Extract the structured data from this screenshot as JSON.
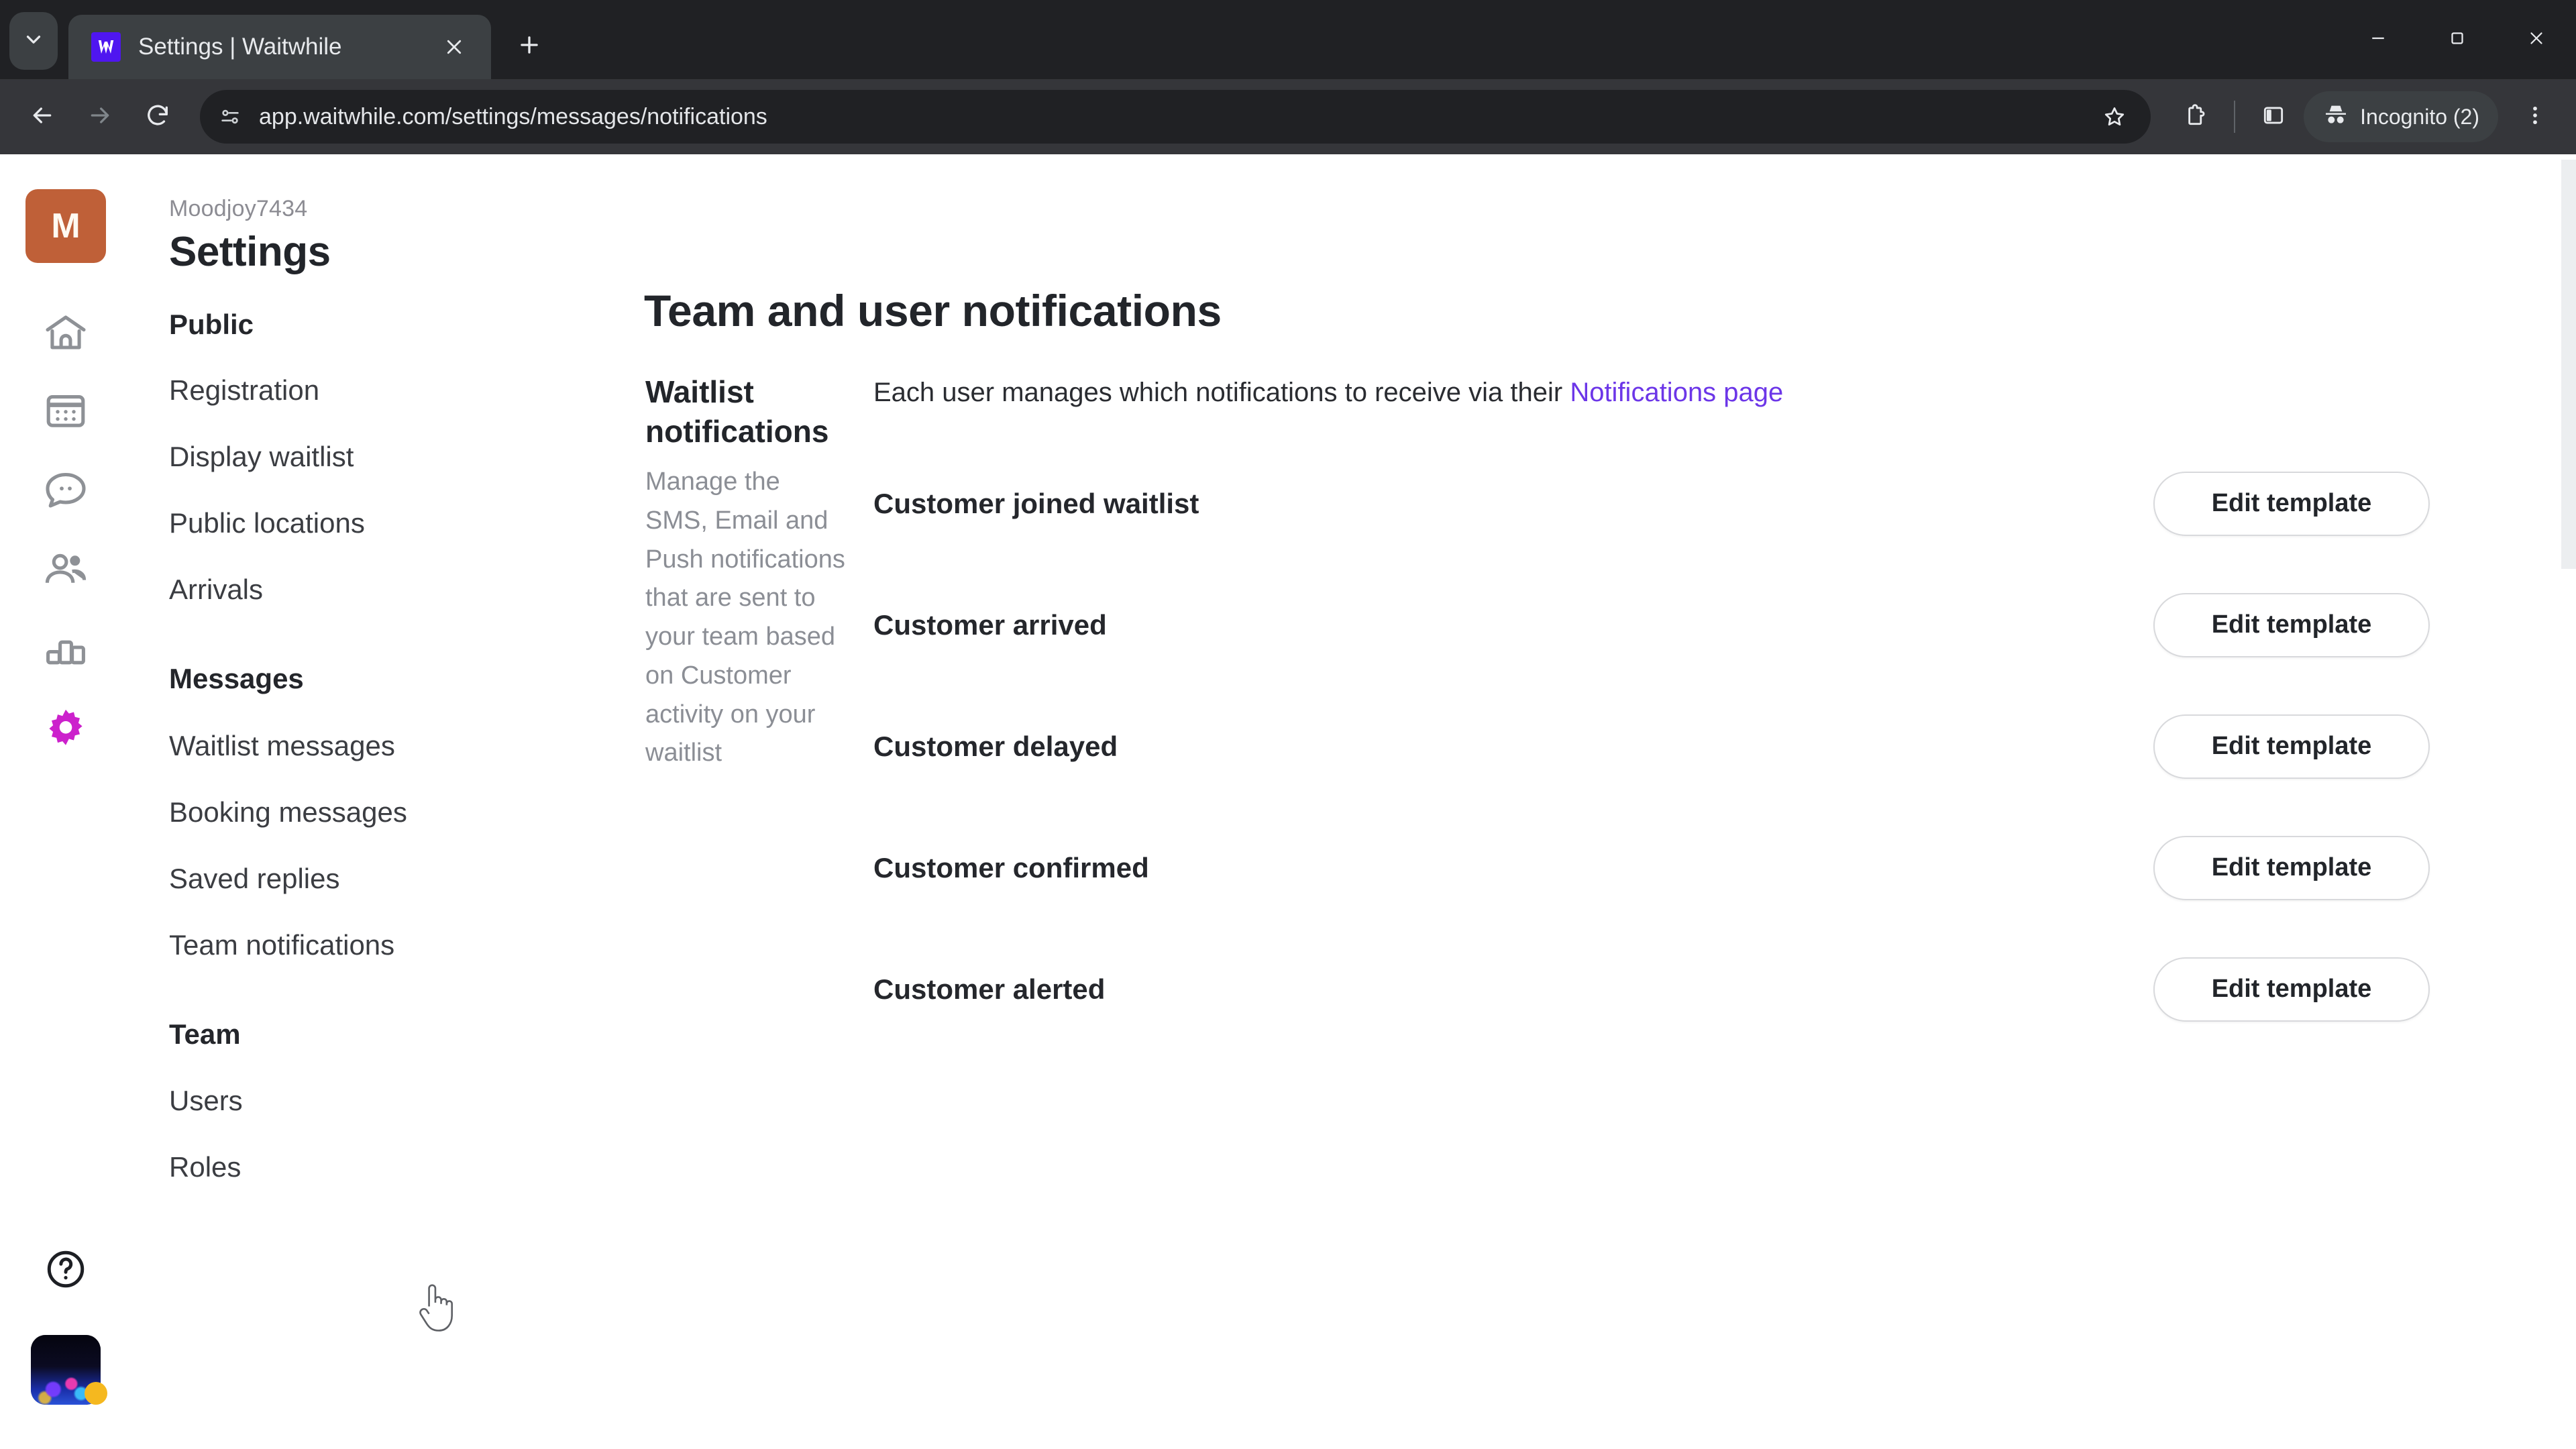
{
  "browser": {
    "tab": {
      "title": "Settings | Waitwhile",
      "favicon_icon": "waitwhile-logo-icon",
      "close_icon": "close-icon"
    },
    "tab_list_icon": "chevron-down-icon",
    "new_tab_icon": "plus-icon",
    "window_controls": {
      "minimize_icon": "minimize-icon",
      "maximize_icon": "maximize-icon",
      "close_icon": "close-icon"
    },
    "toolbar": {
      "back_icon": "arrow-left-icon",
      "forward_icon": "arrow-right-icon",
      "reload_icon": "reload-icon",
      "site_info_icon": "tune-sliders-icon",
      "url": "app.waitwhile.com/settings/messages/notifications",
      "bookmark_icon": "star-icon",
      "extensions_icon": "puzzle-extension-icon",
      "side_panel_icon": "side-panel-icon",
      "incognito_icon": "incognito-hat-icon",
      "incognito_label": "Incognito (2)",
      "menu_icon": "three-dots-vertical-icon"
    }
  },
  "rail": {
    "workspace_initial": "M",
    "items": [
      {
        "name": "home-icon",
        "label": "Home"
      },
      {
        "name": "calendar-icon",
        "label": "Schedule"
      },
      {
        "name": "chat-icon",
        "label": "Messages"
      },
      {
        "name": "people-icon",
        "label": "Customers"
      },
      {
        "name": "bar-chart-icon",
        "label": "Analytics"
      },
      {
        "name": "gear-icon",
        "label": "Settings",
        "active": true,
        "color": "#cc21cc"
      }
    ],
    "help_icon": "help-circle-icon",
    "avatar_icon": "user-avatar",
    "avatar_status_color": "#f5b81f"
  },
  "settings_nav": {
    "account": "Moodjoy7434",
    "title": "Settings",
    "groups": [
      {
        "title": "Public",
        "items": [
          "Registration",
          "Display waitlist",
          "Public locations",
          "Arrivals"
        ]
      },
      {
        "title": "Messages",
        "items": [
          "Waitlist messages",
          "Booking messages",
          "Saved replies",
          "Team notifications"
        ]
      },
      {
        "title": "Team",
        "items": [
          "Users",
          "Roles"
        ]
      }
    ],
    "active_item": "Team notifications"
  },
  "main": {
    "title": "Team and user notifications",
    "section": {
      "heading": "Waitlist notifications",
      "description": "Manage the SMS, Email and Push notifications that are sent to your team based on Customer activity on your waitlist"
    },
    "notice": {
      "text": "Each user manages which notifications to receive via their ",
      "link": "Notifications page",
      "link_color": "#6c36e8"
    },
    "rows": [
      {
        "label": "Customer joined waitlist",
        "action": "Edit template"
      },
      {
        "label": "Customer arrived",
        "action": "Edit template"
      },
      {
        "label": "Customer delayed",
        "action": "Edit template"
      },
      {
        "label": "Customer confirmed",
        "action": "Edit template"
      },
      {
        "label": "Customer alerted",
        "action": "Edit template"
      }
    ]
  }
}
